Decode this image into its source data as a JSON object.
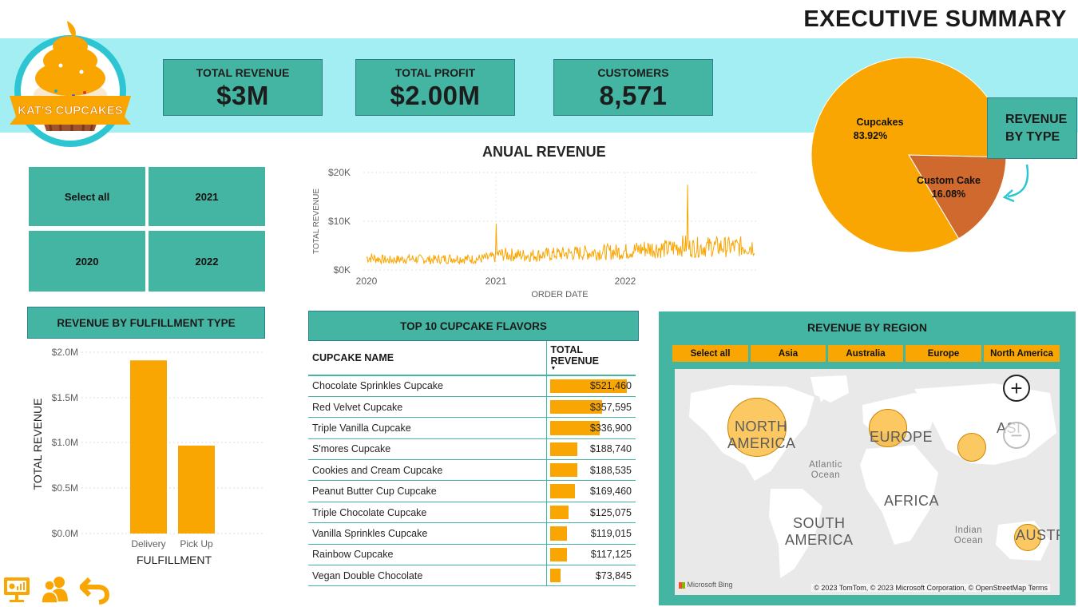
{
  "page": {
    "title": "EXECUTIVE SUMMARY"
  },
  "brand": {
    "logo_text": "KAT'S CUPCAKES"
  },
  "kpis": [
    {
      "label": "TOTAL REVENUE",
      "value": "$3M"
    },
    {
      "label": "TOTAL PROFIT",
      "value": "$2.00M"
    },
    {
      "label": "CUSTOMERS",
      "value": "8,571"
    }
  ],
  "year_slicer": {
    "items": [
      "Select all",
      "2021",
      "2020",
      "2022"
    ]
  },
  "annual_revenue": {
    "title": "ANUAL REVENUE",
    "xlabel": "ORDER DATE",
    "ylabel": "TOTAL REVENUE",
    "y_ticks": [
      "$20K",
      "$10K",
      "$0K"
    ],
    "x_ticks": [
      "2020",
      "2021",
      "2022"
    ]
  },
  "fulfillment": {
    "title": "REVENUE BY FULFILLMENT TYPE",
    "ylabel": "TOTAL REVENUE",
    "xlabel": "FULFILLMENT",
    "y_ticks": [
      "$2.0M",
      "$1.5M",
      "$1.0M",
      "$0.5M",
      "$0.0M"
    ]
  },
  "top_flavors": {
    "title": "TOP 10 CUPCAKE FLAVORS",
    "col_name": "CUPCAKE NAME",
    "col_revenue": "TOTAL REVENUE",
    "rows": [
      {
        "name": "Chocolate Sprinkles Cupcake",
        "revenue": "$521,460",
        "value": 521460
      },
      {
        "name": "Red Velvet Cupcake",
        "revenue": "$357,595",
        "value": 357595
      },
      {
        "name": "Triple Vanilla Cupcake",
        "revenue": "$336,900",
        "value": 336900
      },
      {
        "name": "S'mores Cupcake",
        "revenue": "$188,740",
        "value": 188740
      },
      {
        "name": "Cookies and Cream Cupcake",
        "revenue": "$188,535",
        "value": 188535
      },
      {
        "name": "Peanut Butter Cup Cupcake",
        "revenue": "$169,460",
        "value": 169460
      },
      {
        "name": "Triple Chocolate Cupcake",
        "revenue": "$125,075",
        "value": 125075
      },
      {
        "name": "Vanilla Sprinkles Cupcake",
        "revenue": "$119,015",
        "value": 119015
      },
      {
        "name": "Rainbow Cupcake",
        "revenue": "$117,125",
        "value": 117125
      },
      {
        "name": "Vegan Double Chocolate",
        "revenue": "$73,845",
        "value": 73845
      }
    ]
  },
  "revenue_by_type": {
    "title_line1": "REVENUE",
    "title_line2": "BY TYPE",
    "slices": [
      {
        "name": "Cupcakes",
        "pct_label": "83.92%",
        "value": 83.92,
        "color": "#f9a602"
      },
      {
        "name": "Custom Cake",
        "pct_label": "16.08%",
        "value": 16.08,
        "color": "#d0692d"
      }
    ]
  },
  "region": {
    "title": "REVENUE BY REGION",
    "buttons": [
      "Select all",
      "Asia",
      "Australia",
      "Europe",
      "North America"
    ],
    "map_labels": {
      "north_america_1": "NORTH",
      "north_america_2": "AMERICA",
      "europe": "EUROPE",
      "asia": "ASI",
      "africa": "AFRICA",
      "south_america_1": "SOUTH",
      "south_america_2": "AMERICA",
      "atlantic_1": "Atlantic",
      "atlantic_2": "Ocean",
      "indian_1": "Indian",
      "indian_2": "Ocean",
      "australia": "AUSTR"
    },
    "zoom_in": "+",
    "zoom_out": "−",
    "bing": "Microsoft Bing",
    "copyright": "© 2023 TomTom, © 2023 Microsoft Corporation, © OpenStreetMap  Terms"
  },
  "chart_data": [
    {
      "type": "line",
      "title": "ANUAL REVENUE",
      "xlabel": "ORDER DATE",
      "ylabel": "TOTAL REVENUE",
      "x_range": [
        "2020-01-01",
        "2022-12-31"
      ],
      "ylim": [
        0,
        20000
      ],
      "y_ticks": [
        0,
        10000,
        20000
      ],
      "series": [
        {
          "points": [
            [
              "2020-01-15",
              2500
            ],
            [
              "2020-03-01",
              2000
            ],
            [
              "2020-05-01",
              2300
            ],
            [
              "2020-07-01",
              2100
            ],
            [
              "2020-09-01",
              2400
            ],
            [
              "2020-11-01",
              2200
            ],
            [
              "2020-12-25",
              2600
            ],
            [
              "2021-01-01",
              9500
            ],
            [
              "2021-01-10",
              3200
            ],
            [
              "2021-04-01",
              3000
            ],
            [
              "2021-07-01",
              3300
            ],
            [
              "2021-10-01",
              3600
            ],
            [
              "2022-01-01",
              3800
            ],
            [
              "2022-03-01",
              4400
            ],
            [
              "2022-05-01",
              4300
            ],
            [
              "2022-06-15",
              5000
            ],
            [
              "2022-06-25",
              17500
            ],
            [
              "2022-07-05",
              4600
            ],
            [
              "2022-09-01",
              4800
            ],
            [
              "2022-11-01",
              4700
            ],
            [
              "2022-12-31",
              4900
            ]
          ]
        }
      ]
    },
    {
      "type": "bar",
      "title": "REVENUE BY FULFILLMENT TYPE",
      "categories": [
        "Delivery",
        "Pick Up"
      ],
      "values": [
        1910000,
        970000
      ],
      "xlabel": "FULFILLMENT",
      "ylabel": "TOTAL REVENUE",
      "ylim": [
        0,
        2000000
      ]
    },
    {
      "type": "pie",
      "title": "REVENUE BY TYPE",
      "categories": [
        "Cupcakes",
        "Custom Cake"
      ],
      "values": [
        83.92,
        16.08
      ]
    }
  ],
  "bottom_icons": [
    "presentation-icon",
    "users-icon",
    "back-arrow-icon"
  ],
  "colors": {
    "teal": "#45b5a3",
    "band": "#a2eef3",
    "orange": "#f9a602",
    "rust": "#d0692d"
  }
}
